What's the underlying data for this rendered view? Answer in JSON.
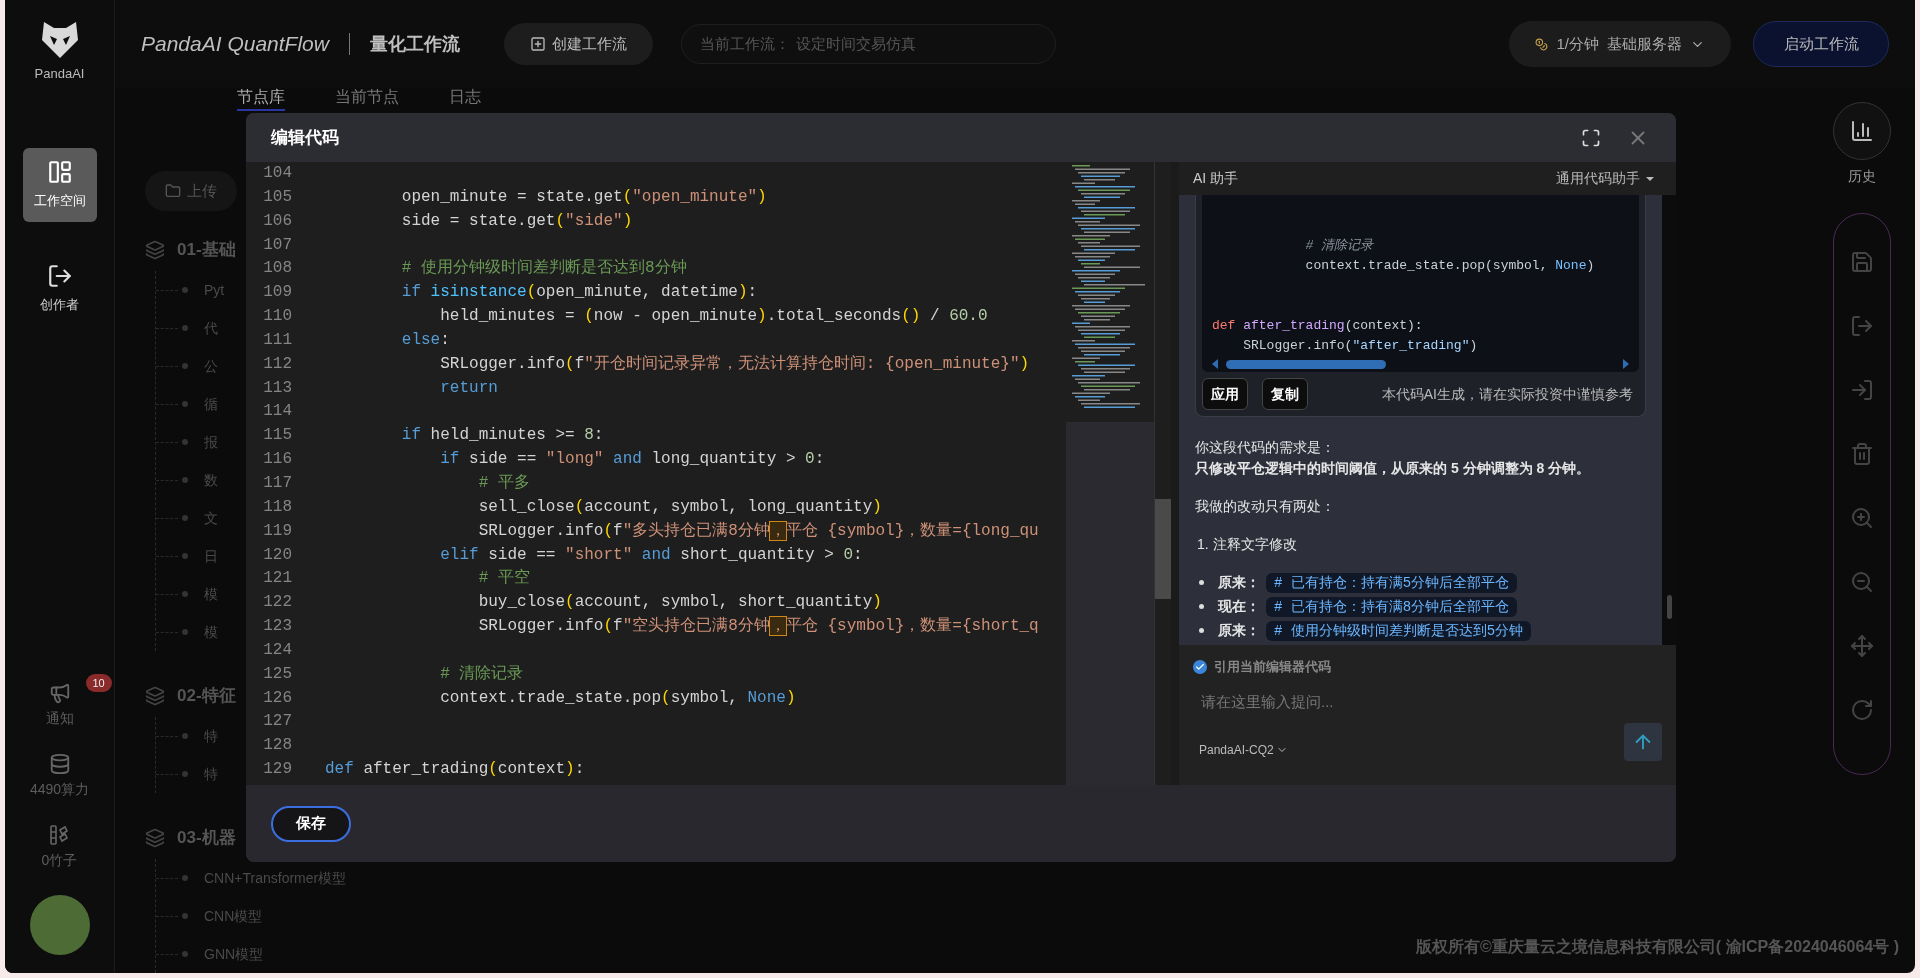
{
  "brand": {
    "logo_text": "PandaAI",
    "title": "PandaAI QuantFlow",
    "subtitle": "量化工作流"
  },
  "header": {
    "create_button": "创建工作流",
    "workflow_label": "当前工作流：",
    "workflow_name": "设定时间交易仿真",
    "rate": "1/分钟",
    "server": "基础服务器",
    "start_button": "启动工作流"
  },
  "nav": {
    "items": [
      {
        "kind": "workspace",
        "label": "工作空间",
        "selected": true
      },
      {
        "kind": "creator",
        "label": "创作者",
        "selected": false
      }
    ],
    "footer_items": [
      {
        "kind": "notice",
        "label": "通知",
        "badge": "10"
      },
      {
        "kind": "compute",
        "label": "4490算力"
      },
      {
        "kind": "bamboo",
        "label": "0竹子"
      }
    ]
  },
  "node_panel": {
    "tabs": [
      {
        "label": "节点库",
        "selected": true
      },
      {
        "label": "当前节点",
        "selected": false
      },
      {
        "label": "日志",
        "selected": false
      }
    ],
    "upload_button": "上传",
    "groups": [
      {
        "title": "01-基础",
        "children": [
          "Pyt",
          "代",
          "公",
          "循",
          "报",
          "数",
          "文",
          "日",
          "模",
          "模"
        ]
      },
      {
        "title": "02-特征",
        "children": [
          "特",
          "特"
        ]
      },
      {
        "title": "03-机器",
        "children": [
          "CNN+Transformer模型",
          "CNN模型",
          "GNN模型"
        ]
      }
    ]
  },
  "canvas": {
    "history_label": "历史",
    "copyright": "版权所有©重庆量云之境信息科技有限公司( 渝ICP备2024046064号 )"
  },
  "editor_dialog": {
    "title": "编辑代码",
    "save_button": "保存",
    "code_lines": [
      {
        "number": "104"
      },
      {
        "number": "105",
        "tokens": [
          {
            "kind": "plain",
            "text": "        open_minute = state.get"
          },
          {
            "kind": "paren",
            "text": "("
          },
          {
            "kind": "string",
            "text": "\"open_minute\""
          },
          {
            "kind": "paren",
            "text": ")"
          }
        ]
      },
      {
        "number": "106",
        "tokens": [
          {
            "kind": "plain",
            "text": "        side = state.get"
          },
          {
            "kind": "paren",
            "text": "("
          },
          {
            "kind": "string",
            "text": "\"side\""
          },
          {
            "kind": "paren",
            "text": ")"
          }
        ]
      },
      {
        "number": "107"
      },
      {
        "number": "108",
        "tokens": [
          {
            "kind": "comment",
            "text": "        # 使用分钟级时间差判断是否达到8分钟"
          }
        ]
      },
      {
        "number": "109",
        "tokens": [
          {
            "kind": "keyword",
            "text": "        if"
          },
          {
            "kind": "builtin",
            "text": " isinstance"
          },
          {
            "kind": "paren",
            "text": "("
          },
          {
            "kind": "plain",
            "text": "open_minute, datetime"
          },
          {
            "kind": "paren",
            "text": ")"
          },
          {
            "kind": "plain",
            "text": ":"
          }
        ]
      },
      {
        "number": "110",
        "tokens": [
          {
            "kind": "plain",
            "text": "            held_minutes = "
          },
          {
            "kind": "paren",
            "text": "("
          },
          {
            "kind": "plain",
            "text": "now - open_minute"
          },
          {
            "kind": "paren",
            "text": ")"
          },
          {
            "kind": "plain",
            "text": ".total_seconds"
          },
          {
            "kind": "paren",
            "text": "()"
          },
          {
            "kind": "plain",
            "text": " / "
          },
          {
            "kind": "number",
            "text": "60.0"
          }
        ]
      },
      {
        "number": "111",
        "tokens": [
          {
            "kind": "keyword",
            "text": "        else"
          },
          {
            "kind": "plain",
            "text": ":"
          }
        ]
      },
      {
        "number": "112",
        "tokens": [
          {
            "kind": "plain",
            "text": "            SRLogger.info"
          },
          {
            "kind": "paren",
            "text": "("
          },
          {
            "kind": "plain",
            "text": "f"
          },
          {
            "kind": "string",
            "text": "\"开仓时间记录异常，无法计算持仓时间: {open_minute}\""
          },
          {
            "kind": "paren",
            "text": ")"
          }
        ]
      },
      {
        "number": "113",
        "tokens": [
          {
            "kind": "keyword",
            "text": "            return"
          }
        ]
      },
      {
        "number": "114"
      },
      {
        "number": "115",
        "tokens": [
          {
            "kind": "keyword",
            "text": "        if"
          },
          {
            "kind": "plain",
            "text": " held_minutes >= "
          },
          {
            "kind": "number",
            "text": "8"
          },
          {
            "kind": "plain",
            "text": ":"
          }
        ]
      },
      {
        "number": "116",
        "tokens": [
          {
            "kind": "keyword",
            "text": "            if"
          },
          {
            "kind": "plain",
            "text": " side == "
          },
          {
            "kind": "string",
            "text": "\"long\""
          },
          {
            "kind": "keyword",
            "text": " and"
          },
          {
            "kind": "plain",
            "text": " long_quantity > "
          },
          {
            "kind": "number",
            "text": "0"
          },
          {
            "kind": "plain",
            "text": ":"
          }
        ]
      },
      {
        "number": "117",
        "tokens": [
          {
            "kind": "comment",
            "text": "                # 平多"
          }
        ]
      },
      {
        "number": "118",
        "tokens": [
          {
            "kind": "plain",
            "text": "                sell_close"
          },
          {
            "kind": "paren",
            "text": "("
          },
          {
            "kind": "plain",
            "text": "account, symbol, long_quantity"
          },
          {
            "kind": "paren",
            "text": ")"
          }
        ]
      },
      {
        "number": "119",
        "tokens": [
          {
            "kind": "plain",
            "text": "                SRLogger.info"
          },
          {
            "kind": "paren",
            "text": "("
          },
          {
            "kind": "plain",
            "text": "f"
          },
          {
            "kind": "string",
            "text": "\"多头持仓已满8分钟"
          },
          {
            "kind": "mark",
            "text": "，"
          },
          {
            "kind": "string",
            "text": "平仓 {symbol}，数量={long_qu"
          }
        ]
      },
      {
        "number": "120",
        "tokens": [
          {
            "kind": "keyword",
            "text": "            elif"
          },
          {
            "kind": "plain",
            "text": " side == "
          },
          {
            "kind": "string",
            "text": "\"short\""
          },
          {
            "kind": "keyword",
            "text": " and"
          },
          {
            "kind": "plain",
            "text": " short_quantity > "
          },
          {
            "kind": "number",
            "text": "0"
          },
          {
            "kind": "plain",
            "text": ":"
          }
        ]
      },
      {
        "number": "121",
        "tokens": [
          {
            "kind": "comment",
            "text": "                # 平空"
          }
        ]
      },
      {
        "number": "122",
        "tokens": [
          {
            "kind": "plain",
            "text": "                buy_close"
          },
          {
            "kind": "paren",
            "text": "("
          },
          {
            "kind": "plain",
            "text": "account, symbol, short_quantity"
          },
          {
            "kind": "paren",
            "text": ")"
          }
        ]
      },
      {
        "number": "123",
        "tokens": [
          {
            "kind": "plain",
            "text": "                SRLogger.info"
          },
          {
            "kind": "paren",
            "text": "("
          },
          {
            "kind": "plain",
            "text": "f"
          },
          {
            "kind": "string",
            "text": "\"空头持仓已满8分钟"
          },
          {
            "kind": "mark",
            "text": "，"
          },
          {
            "kind": "string",
            "text": "平仓 {symbol}，数量={short_q"
          }
        ]
      },
      {
        "number": "124"
      },
      {
        "number": "125",
        "tokens": [
          {
            "kind": "comment",
            "text": "            # 清除记录"
          }
        ]
      },
      {
        "number": "126",
        "tokens": [
          {
            "kind": "plain",
            "text": "            context.trade_state.pop"
          },
          {
            "kind": "paren",
            "text": "("
          },
          {
            "kind": "plain",
            "text": "symbol, "
          },
          {
            "kind": "keyword",
            "text": "None"
          },
          {
            "kind": "paren",
            "text": ")"
          }
        ]
      },
      {
        "number": "127"
      },
      {
        "number": "128"
      },
      {
        "number": "129",
        "tokens": [
          {
            "kind": "keyword",
            "text": "def"
          },
          {
            "kind": "plain",
            "text": " after_trading"
          },
          {
            "kind": "paren",
            "text": "("
          },
          {
            "kind": "plain",
            "text": "context"
          },
          {
            "kind": "paren",
            "text": ")"
          },
          {
            "kind": "plain",
            "text": ":"
          }
        ]
      }
    ],
    "assistant": {
      "title": "AI 助手",
      "mode": "通用代码助手",
      "code_lines": [
        {
          "kind": "code",
          "tokens": [
            {
              "kind": "comment",
              "text": "            # 清除记录"
            }
          ]
        },
        {
          "kind": "code",
          "tokens": [
            {
              "kind": "plain",
              "text": "            context.trade_state.pop(symbol, "
            },
            {
              "kind": "constant",
              "text": "None"
            },
            {
              "kind": "plain",
              "text": ")"
            }
          ]
        },
        {
          "kind": "blank"
        },
        {
          "kind": "blank"
        },
        {
          "kind": "code",
          "tokens": [
            {
              "kind": "keyword",
              "text": "def"
            },
            {
              "kind": "function",
              "text": " after_trading"
            },
            {
              "kind": "plain",
              "text": "(context):"
            }
          ]
        },
        {
          "kind": "code",
          "tokens": [
            {
              "kind": "plain",
              "text": "    SRLogger.info("
            },
            {
              "kind": "string",
              "text": "\"after_trading\""
            },
            {
              "kind": "plain",
              "text": ")"
            }
          ]
        }
      ],
      "apply_button": "应用",
      "copy_button": "复制",
      "disclaimer": "本代码AI生成，请在实际投资中谨慎参考",
      "messages": [
        {
          "kind": "text",
          "text": "你这段代码的需求是："
        },
        {
          "kind": "bold",
          "text": "只修改平仓逻辑中的时间阈值，从原来的 5 分钟调整为 8 分钟。"
        },
        {
          "kind": "text",
          "text": "我做的改动只有两处："
        },
        {
          "kind": "heading",
          "text": "1. 注释文字修改"
        },
        {
          "kind": "bullet",
          "label": "原来：",
          "code": "# 已有持仓：持有满5分钟后全部平仓"
        },
        {
          "kind": "bullet",
          "label": "现在：",
          "code": "# 已有持仓：持有满8分钟后全部平仓"
        },
        {
          "kind": "bullet",
          "label": "原来：",
          "code": "# 使用分钟级时间差判断是否达到5分钟"
        }
      ],
      "quote_editor": {
        "label": "引用当前编辑器代码",
        "checked": true
      },
      "input_placeholder": "请在这里输入提问...",
      "model": "PandaAI-CQ2"
    }
  }
}
